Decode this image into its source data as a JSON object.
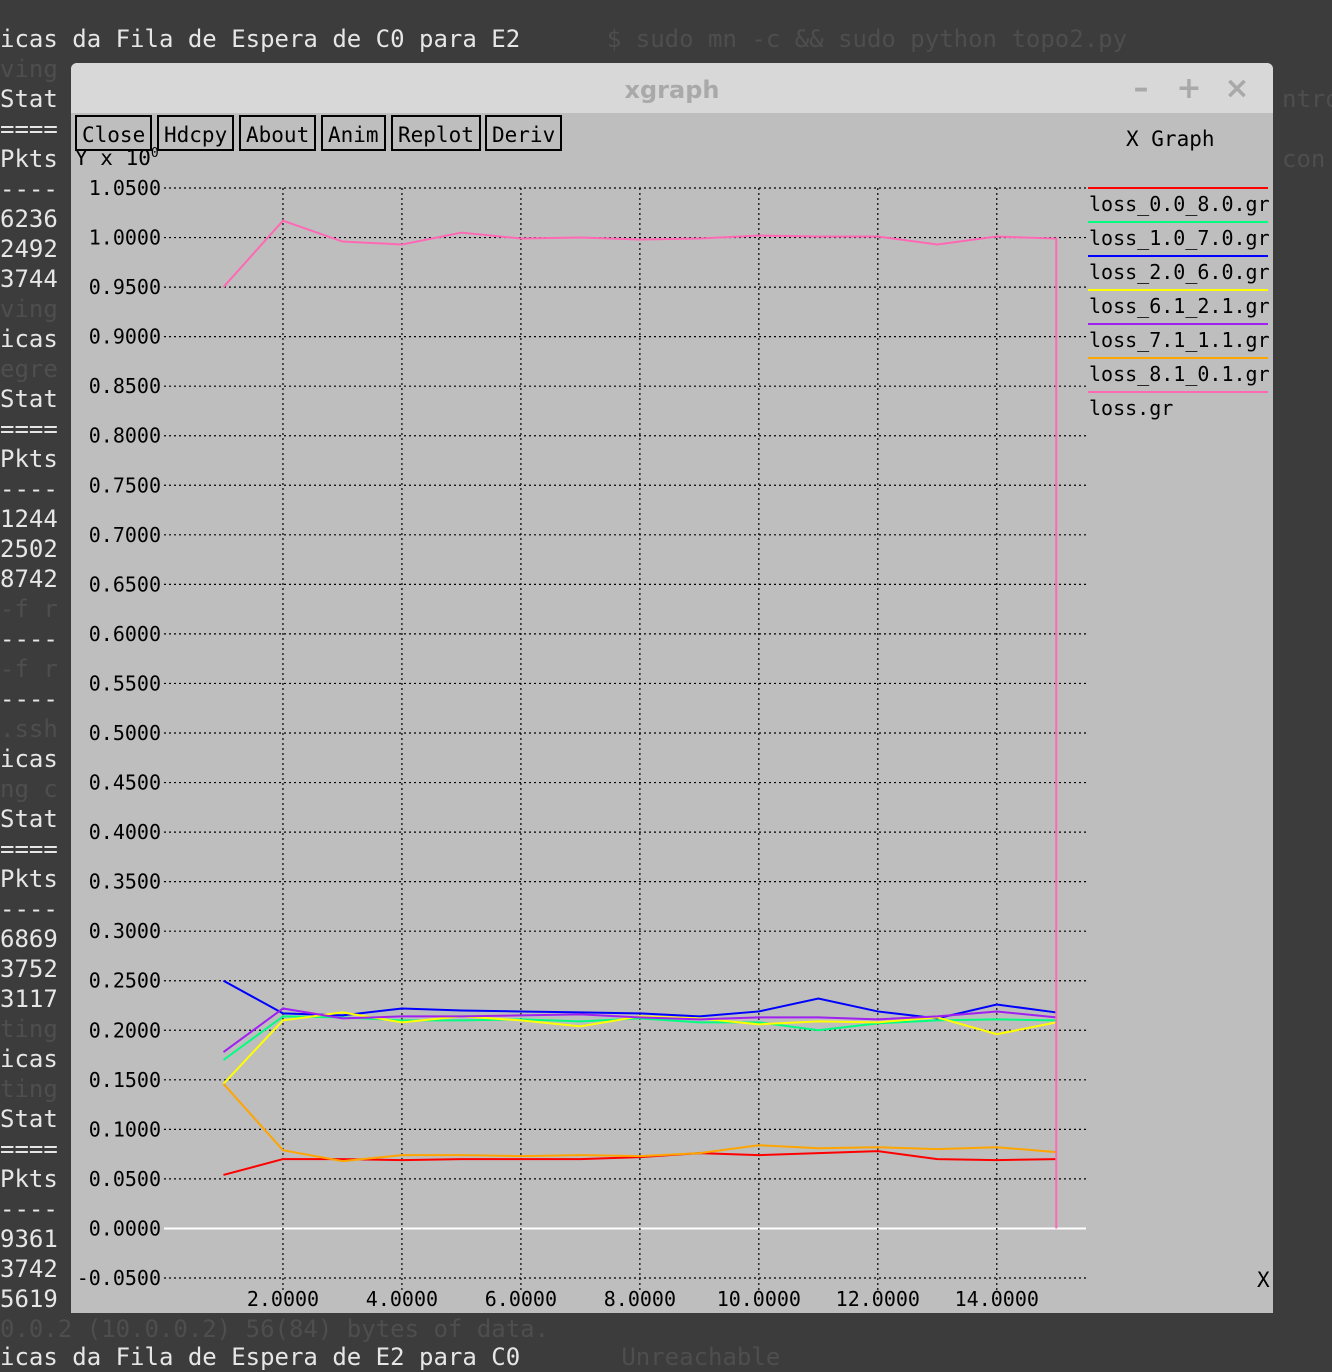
{
  "terminal": {
    "top_line": "icas da Fila de Espera de C0 para E2",
    "top_line_faint": "$ sudo mn -c && sudo python topo2.py",
    "bottom_faint": "0.0.2 (10.0.0.2) 56(84) bytes of data.",
    "bottom_line": "icas da Fila de Espera de E2 para C0",
    "bottom_line_faint": "Unreachable",
    "left_column": [
      "ving",
      "Stat",
      "====",
      "Pkts",
      "----",
      "6236",
      "2492",
      "3744",
      "ving",
      "icas",
      "egre",
      "Stat",
      "====",
      "Pkts",
      "----",
      "1244",
      "2502",
      "8742",
      "-f r",
      "----",
      "-f r",
      "----",
      ".ssh",
      "icas",
      "ng c",
      "Stat",
      "====",
      "Pkts",
      "----",
      "6869",
      "3752",
      "3117",
      "ting",
      "icas",
      "ting",
      "Stat",
      "====",
      "Pkts",
      "----",
      "9361",
      "3742",
      "5619"
    ],
    "right_faint": [
      "ntro",
      "con"
    ]
  },
  "window": {
    "title": "xgraph",
    "controls": {
      "minimize": "–",
      "maximize": "+",
      "close": "×"
    }
  },
  "toolbar": {
    "buttons": [
      "Close",
      "Hdcpy",
      "About",
      "Anim",
      "Replot",
      "Deriv"
    ]
  },
  "graph": {
    "title": "X Graph",
    "y_label": "Y x 10",
    "y_label_exp": "0",
    "x_label": "X",
    "legend": [
      {
        "name": "loss_0.0_8.0.gr",
        "color": "#ff0000"
      },
      {
        "name": "loss_1.0_7.0.gr",
        "color": "#00ff80"
      },
      {
        "name": "loss_2.0_6.0.gr",
        "color": "#0000ff"
      },
      {
        "name": "loss_6.1_2.1.gr",
        "color": "#ffff00"
      },
      {
        "name": "loss_7.1_1.1.gr",
        "color": "#a020f0"
      },
      {
        "name": "loss_8.1_0.1.gr",
        "color": "#ffa500"
      },
      {
        "name": "loss.gr",
        "color": "#ff69b4"
      }
    ]
  },
  "chart_data": {
    "type": "line",
    "title": "X Graph",
    "xlabel": "X",
    "ylabel": "Y x 10^0",
    "xlim": [
      0,
      15.5
    ],
    "ylim": [
      -0.05,
      1.05
    ],
    "grid": true,
    "legend_position": "right",
    "x_ticks": [
      "2.0000",
      "4.0000",
      "6.0000",
      "8.0000",
      "10.0000",
      "12.0000",
      "14.0000"
    ],
    "y_ticks": [
      "1.0500",
      "1.0000",
      "0.9500",
      "0.9000",
      "0.8500",
      "0.8000",
      "0.7500",
      "0.7000",
      "0.6500",
      "0.6000",
      "0.5500",
      "0.5000",
      "0.4500",
      "0.4000",
      "0.3500",
      "0.3000",
      "0.2500",
      "0.2000",
      "0.1500",
      "0.1000",
      "0.0500",
      "0.0000",
      "-0.0500"
    ],
    "x": [
      1,
      2,
      3,
      4,
      5,
      6,
      7,
      8,
      9,
      10,
      11,
      12,
      13,
      14,
      15
    ],
    "series": [
      {
        "name": "loss_0.0_8.0.gr",
        "color": "#ff0000",
        "values": [
          0.054,
          0.07,
          0.07,
          0.069,
          0.07,
          0.07,
          0.07,
          0.072,
          0.076,
          0.074,
          0.076,
          0.078,
          0.07,
          0.069,
          0.07
        ]
      },
      {
        "name": "loss_1.0_7.0.gr",
        "color": "#00ff80",
        "values": [
          0.17,
          0.214,
          0.213,
          0.21,
          0.21,
          0.211,
          0.209,
          0.212,
          0.208,
          0.208,
          0.2,
          0.207,
          0.21,
          0.211,
          0.21
        ]
      },
      {
        "name": "loss_2.0_6.0.gr",
        "color": "#0000ff",
        "values": [
          0.25,
          0.217,
          0.215,
          0.222,
          0.22,
          0.219,
          0.218,
          0.217,
          0.214,
          0.219,
          0.232,
          0.219,
          0.212,
          0.226,
          0.218
        ]
      },
      {
        "name": "loss_6.1_2.1.gr",
        "color": "#ffff00",
        "values": [
          0.146,
          0.21,
          0.218,
          0.208,
          0.214,
          0.21,
          0.204,
          0.214,
          0.212,
          0.206,
          0.209,
          0.208,
          0.213,
          0.196,
          0.208
        ]
      },
      {
        "name": "loss_7.1_1.1.gr",
        "color": "#a020f0",
        "values": [
          0.178,
          0.222,
          0.212,
          0.214,
          0.214,
          0.215,
          0.216,
          0.213,
          0.211,
          0.213,
          0.213,
          0.211,
          0.214,
          0.219,
          0.213
        ]
      },
      {
        "name": "loss_8.1_0.1.gr",
        "color": "#ffa500",
        "values": [
          0.146,
          0.079,
          0.068,
          0.074,
          0.074,
          0.073,
          0.074,
          0.073,
          0.076,
          0.084,
          0.081,
          0.082,
          0.08,
          0.082,
          0.077
        ]
      },
      {
        "name": "loss.gr",
        "color": "#ff69b4",
        "values": [
          0.95,
          1.017,
          0.996,
          0.993,
          1.005,
          0.999,
          1.0,
          0.998,
          0.999,
          1.002,
          1.001,
          1.001,
          0.993,
          1.001,
          0.999
        ]
      }
    ],
    "final_drop": {
      "series": "loss.gr",
      "x": 15,
      "to": 0.0
    }
  }
}
